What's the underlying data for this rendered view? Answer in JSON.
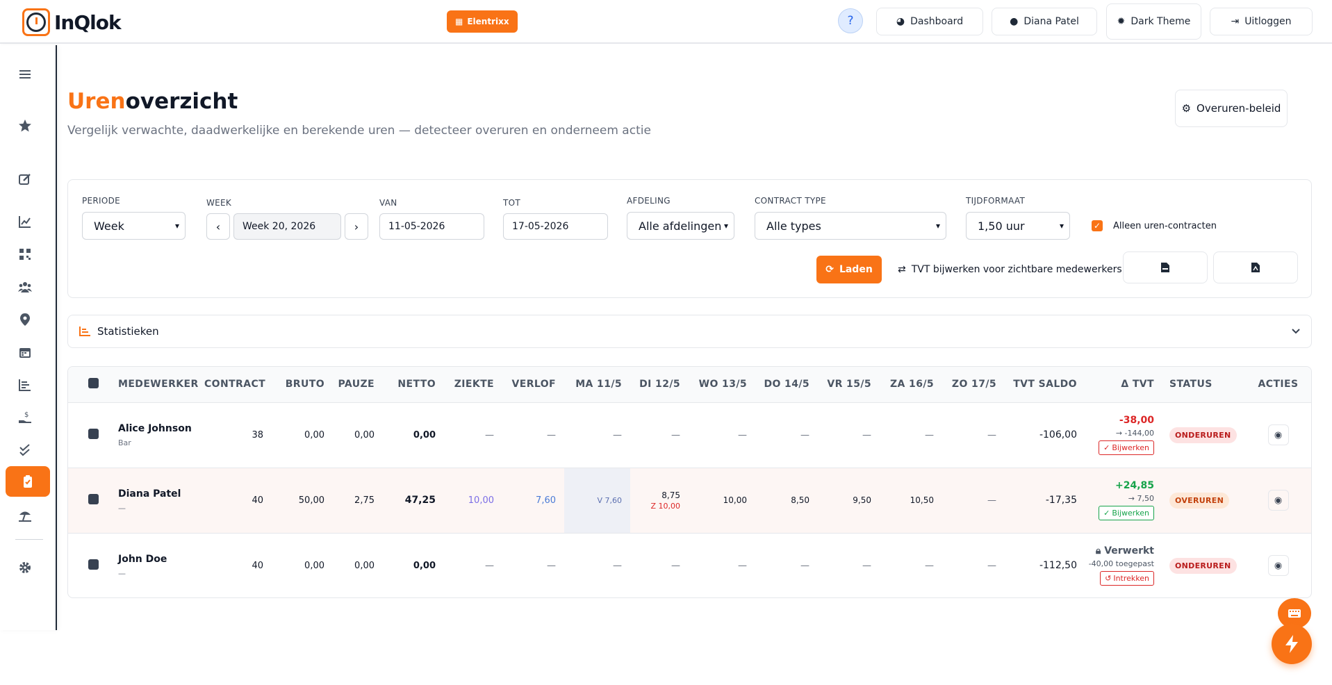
{
  "header": {
    "logo_text": "InQlok",
    "company": "Elentrixx",
    "help": "?",
    "dashboard": "Dashboard",
    "user": "Diana Patel",
    "theme": "Dark Theme",
    "logout": "Uitloggen"
  },
  "page": {
    "title_accent": "Uren",
    "title_rest": "overzicht",
    "subtitle": "Vergelijk verwachte, daadwerkelijke en berekende uren — detecteer overuren en onderneem actie",
    "policy_button": "Overuren-beleid"
  },
  "filters": {
    "periode_label": "PERIODE",
    "periode_value": "Week",
    "week_label": "WEEK",
    "week_value": "Week 20, 2026",
    "van_label": "VAN",
    "van_value": "11-05-2026",
    "tot_label": "TOT",
    "tot_value": "17-05-2026",
    "afdeling_label": "AFDELING",
    "afdeling_value": "Alle afdelingen",
    "contract_label": "CONTRACT TYPE",
    "contract_value": "Alle types",
    "tijd_label": "TIJDFORMAAT",
    "tijd_value": "1,50 uur",
    "only_hours_label": "Alleen uren-contracten",
    "load_button": "Laden",
    "tvt_button": "TVT bijwerken voor zichtbare medewerkers"
  },
  "stats": {
    "label": "Statistieken"
  },
  "table": {
    "headers": [
      "MEDEWERKER",
      "CONTRACT",
      "BRUTO",
      "PAUZE",
      "NETTO",
      "ZIEKTE",
      "VERLOF",
      "MA 11/5",
      "DI 12/5",
      "WO 13/5",
      "DO 14/5",
      "VR 15/5",
      "ZA 16/5",
      "ZO 17/5",
      "TVT SALDO",
      "Δ TVT",
      "STATUS",
      "ACTIES"
    ],
    "rows": [
      {
        "name": "Alice Johnson",
        "sub": "Bar",
        "contract": "38",
        "bruto": "0,00",
        "pauze": "0,00",
        "netto": "0,00",
        "ziekte": "—",
        "verlof": "—",
        "ma": "—",
        "di": "—",
        "di_extra": "",
        "wo": "—",
        "do": "—",
        "vr": "—",
        "za": "—",
        "zo": "—",
        "saldo": "-106,00",
        "delta": "-38,00",
        "delta_sub": "→ -144,00",
        "action": "Bijwerken",
        "status": "ONDERUREN"
      },
      {
        "name": "Diana Patel",
        "sub": "—",
        "contract": "40",
        "bruto": "50,00",
        "pauze": "2,75",
        "netto": "47,25",
        "ziekte": "10,00",
        "verlof": "7,60",
        "ma": "V 7,60",
        "di": "8,75",
        "di_extra": "Z 10,00",
        "wo": "10,00",
        "do": "8,50",
        "vr": "9,50",
        "za": "10,50",
        "zo": "—",
        "saldo": "-17,35",
        "delta": "+24,85",
        "delta_sub": "→ 7,50",
        "action": "Bijwerken",
        "status": "OVERUREN"
      },
      {
        "name": "John Doe",
        "sub": "—",
        "contract": "40",
        "bruto": "0,00",
        "pauze": "0,00",
        "netto": "0,00",
        "ziekte": "—",
        "verlof": "—",
        "ma": "—",
        "di": "—",
        "di_extra": "",
        "wo": "—",
        "do": "—",
        "vr": "—",
        "za": "—",
        "zo": "—",
        "saldo": "-112,50",
        "delta": "Verwerkt",
        "delta_sub": "-40,00 toegepast",
        "action": "Intrekken",
        "status": "ONDERUREN"
      }
    ]
  },
  "colors": {
    "accent": "#f97316",
    "danger": "#dc2626",
    "success": "#16a34a"
  }
}
